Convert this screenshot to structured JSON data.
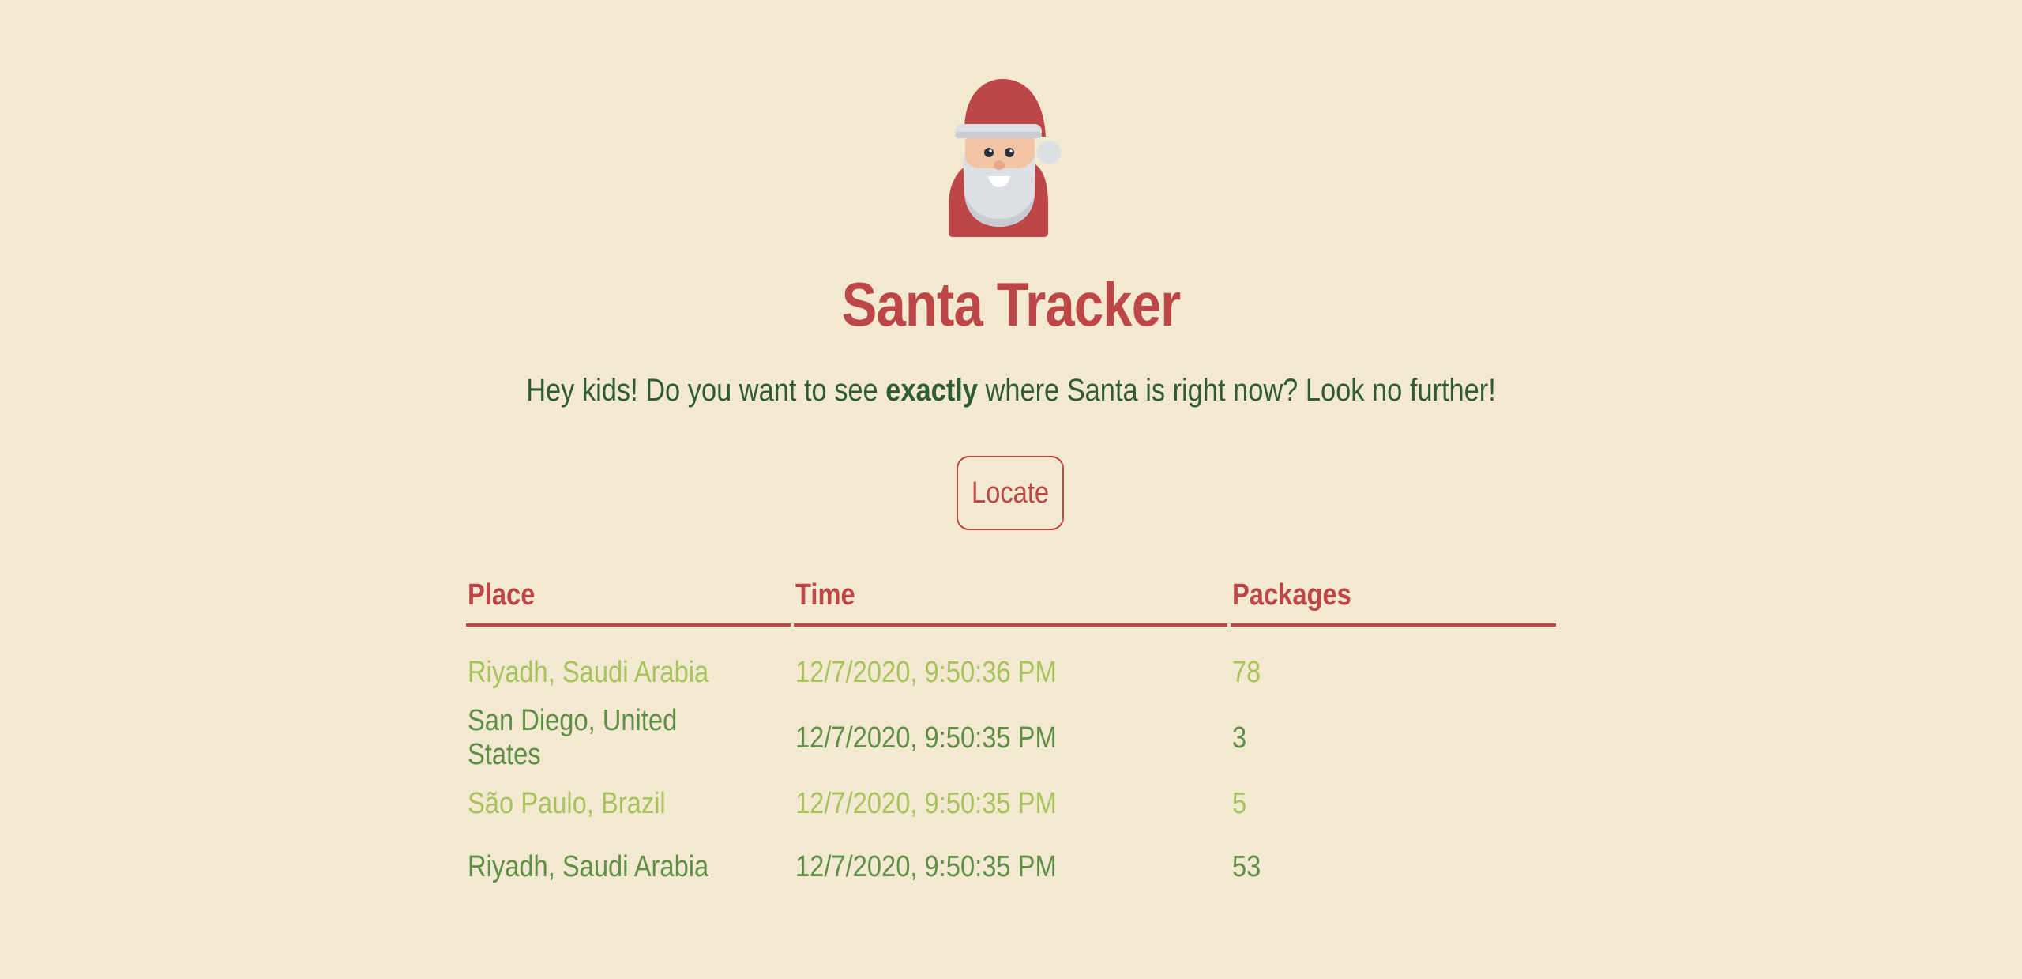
{
  "app": {
    "title": "Santa Tracker",
    "intro_before": "Hey kids! Do you want to see ",
    "intro_emphasis": "exactly",
    "intro_after": " where Santa is right now? Look no further!",
    "locate_label": "Locate",
    "logo_icon": "santa-icon"
  },
  "table": {
    "headers": [
      "Place",
      "Time",
      "Packages"
    ],
    "rows": [
      {
        "place": "Riyadh, Saudi Arabia",
        "time": "12/7/2020, 9:50:36 PM",
        "packages": "78"
      },
      {
        "place": "San Diego, United States",
        "time": "12/7/2020, 9:50:35 PM",
        "packages": "3"
      },
      {
        "place": "São Paulo, Brazil",
        "time": "12/7/2020, 9:50:35 PM",
        "packages": "5"
      },
      {
        "place": "Riyadh, Saudi Arabia",
        "time": "12/7/2020, 9:50:35 PM",
        "packages": "53"
      }
    ]
  },
  "colors": {
    "background": "#f3e8d0",
    "accent_red": "#bd4646",
    "text_dark_green": "#2f5c32",
    "row_light_green": "#a7c45c",
    "row_mid_green": "#5e8f45"
  }
}
